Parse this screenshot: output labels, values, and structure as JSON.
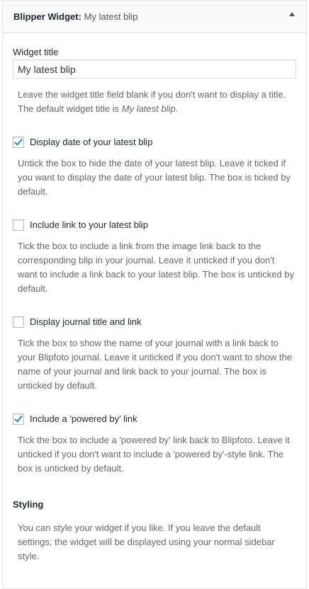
{
  "header": {
    "widget_name": "Blipper Widget:",
    "instance_title": "My latest blip"
  },
  "title_field": {
    "label": "Widget title",
    "value": "My latest blip"
  },
  "title_desc": {
    "text": "Leave the widget title field blank if you don't want to display a title. The default widget title is ",
    "italic": "My latest blip",
    "end": "."
  },
  "options": [
    {
      "label": "Display date of your latest blip",
      "checked": true,
      "desc": "Untick the box to hide the date of your latest blip. Leave it ticked if you want to display the date of your latest blip. The box is ticked by default."
    },
    {
      "label": "Include link to your latest blip",
      "checked": false,
      "desc": "Tick the box to include a link from the image link back to the corresponding blip in your journal. Leave it unticked if you don't want to include a link back to your latest blip. The box is unticked by default."
    },
    {
      "label": "Display journal title and link",
      "checked": false,
      "desc": "Tick the box to show the name of your journal with a link back to your Blipfoto journal. Leave it unticked if you don't want to show the name of your journal and link back to your journal. The box is unticked by default."
    },
    {
      "label": "Include a 'powered by' link",
      "checked": true,
      "desc": "Tick the box to include a 'powered by' link back to Blipfoto. Leave it unticked if you don't want to include a 'powered by'-style link. The box is unticked by default."
    }
  ],
  "styling": {
    "heading": "Styling",
    "desc": "You can style your widget if you like. If you leave the default settings, the widget will be displayed using your normal sidebar style."
  }
}
